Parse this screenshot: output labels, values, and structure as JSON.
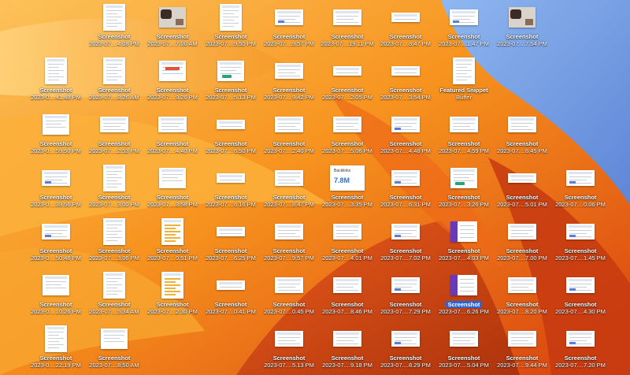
{
  "wallpaper": {
    "name": "macos-ventura-orange",
    "colors": [
      "#fbb03b",
      "#f7931e",
      "#e8520f",
      "#c63a10",
      "#7aa6e8"
    ]
  },
  "desktop": {
    "rows": [
      {
        "icons": [
          {
            "name": "Screenshot",
            "sub": "2023-07....4.08 PM",
            "thumb": "doc"
          },
          {
            "name": "Screenshot",
            "sub": "2023-07....7.00 AM",
            "thumb": "photo"
          },
          {
            "name": "Screenshot",
            "sub": "2023-07....9.50 PM",
            "thumb": "doc"
          },
          {
            "name": "Screenshot",
            "sub": "2023-07....9.57 PM",
            "thumb": "wide"
          },
          {
            "name": "Screenshot",
            "sub": "2023-07....19.11 PM",
            "thumb": "wide"
          },
          {
            "name": "Screenshot",
            "sub": "2023-07....8.47 PM",
            "thumb": "narrow"
          },
          {
            "name": "Screenshot",
            "sub": "2023-07....1.47 PM",
            "thumb": "wide"
          },
          {
            "name": "Screenshot",
            "sub": "2023-07....7.54 PM",
            "thumb": "photo"
          }
        ]
      },
      {
        "icons": [
          {
            "name": "Screenshot",
            "sub": "2023-0....41.48 PM",
            "thumb": "tall"
          },
          {
            "name": "Screenshot",
            "sub": "2023-07....8.26 AM",
            "thumb": "tall"
          },
          {
            "name": "Screenshot",
            "sub": "2023-07....9.26 PM",
            "thumb": "redbtn"
          },
          {
            "name": "Screenshot",
            "sub": "2023-07....5.13 PM",
            "thumb": "greenbtn"
          },
          {
            "name": "Screenshot",
            "sub": "2023-07....9.42 PM",
            "thumb": "wide"
          },
          {
            "name": "Screenshot",
            "sub": "2023-07....2.05 PM",
            "thumb": "narrow"
          },
          {
            "name": "Screenshot",
            "sub": "2023-07....3.54 PM",
            "thumb": "narrow"
          },
          {
            "name": "Featured Snippet",
            "sub": "Buffer",
            "thumb": "doc"
          }
        ]
      },
      {
        "icons": [
          {
            "name": "Screenshot",
            "sub": "2023-0....59.50 PM",
            "thumb": "std"
          },
          {
            "name": "Screenshot",
            "sub": "2023-07....2.53 PM",
            "thumb": "wide"
          },
          {
            "name": "Screenshot",
            "sub": "2023-07....4.40 PM",
            "thumb": "wide"
          },
          {
            "name": "Screenshot",
            "sub": "2023-07....6.50 PM",
            "thumb": "narrow"
          },
          {
            "name": "Screenshot",
            "sub": "2023-07....2.40 PM",
            "thumb": "wide"
          },
          {
            "name": "Screenshot",
            "sub": "2023-07....5.06 PM",
            "thumb": "wide"
          },
          {
            "name": "Screenshot",
            "sub": "2023-07....4.48 PM",
            "thumb": "wide"
          },
          {
            "name": "Screenshot",
            "sub": "2023-07....4.59 PM",
            "thumb": "wide"
          },
          {
            "name": "Screenshot",
            "sub": "2023-07....6.45 PM",
            "thumb": "wide"
          }
        ]
      },
      {
        "icons": [
          {
            "name": "Screenshot",
            "sub": "2023-0....39.56 PM",
            "thumb": "wide"
          },
          {
            "name": "Screenshot",
            "sub": "2023-07....3.00 PM",
            "thumb": "tall"
          },
          {
            "name": "Screenshot",
            "sub": "2023-07....3.58 PM",
            "thumb": "std"
          },
          {
            "name": "Screenshot",
            "sub": "2023-07....6.16 PM",
            "thumb": "narrow"
          },
          {
            "name": "Screenshot",
            "sub": "2023-07....8.47 PM",
            "thumb": "wide"
          },
          {
            "name": "Screenshot",
            "sub": "2023-07....3.35 PM",
            "thumb": "backlinks",
            "label": "Backlinks",
            "value": "7.8M"
          },
          {
            "name": "Screenshot",
            "sub": "2023-07....6.31 PM",
            "thumb": "wide"
          },
          {
            "name": "Screenshot",
            "sub": "2023-07....3.26 PM",
            "thumb": "greenbtn"
          },
          {
            "name": "Screenshot",
            "sub": "2023-07....5.01 PM",
            "thumb": "narrow"
          },
          {
            "name": "Screenshot",
            "sub": "2023-07....0.06 PM",
            "thumb": "wide"
          }
        ]
      },
      {
        "icons": [
          {
            "name": "Screenshot",
            "sub": "2023-0....50.46 PM",
            "thumb": "wide"
          },
          {
            "name": "Screenshot",
            "sub": "2023-07....3.06 PM",
            "thumb": "tall"
          },
          {
            "name": "Screenshot",
            "sub": "2023-07....0.51 PM",
            "thumb": "yellowdoc"
          },
          {
            "name": "Screenshot",
            "sub": "2023-07....6.25 PM",
            "thumb": "narrow"
          },
          {
            "name": "Screenshot",
            "sub": "2023-07....9.57 PM",
            "thumb": "wide"
          },
          {
            "name": "Screenshot",
            "sub": "2023-07....4.01 PM",
            "thumb": "wide"
          },
          {
            "name": "Screenshot",
            "sub": "2023-07....7.02 PM",
            "thumb": "wide"
          },
          {
            "name": "Screenshot",
            "sub": "2023-07....4.03 PM",
            "thumb": "purple"
          },
          {
            "name": "Screenshot",
            "sub": "2023-07....7.00 PM",
            "thumb": "wide"
          },
          {
            "name": "Screenshot",
            "sub": "2023-07....1.45 PM",
            "thumb": "wide"
          }
        ]
      },
      {
        "icons": [
          {
            "name": "Screenshot",
            "sub": "2023-0....10.26 PM",
            "thumb": "std"
          },
          {
            "name": "Screenshot",
            "sub": "2023-07....5.34 AM",
            "thumb": "tall"
          },
          {
            "name": "Screenshot",
            "sub": "2023-07....2.30 PM",
            "thumb": "yellowdoc"
          },
          {
            "name": "Screenshot",
            "sub": "2023-07....0.41 PM",
            "thumb": "narrow"
          },
          {
            "name": "Screenshot",
            "sub": "2023-07....0.45 PM",
            "thumb": "wide"
          },
          {
            "name": "Screenshot",
            "sub": "2023-07....8.46 PM",
            "thumb": "wide"
          },
          {
            "name": "Screenshot",
            "sub": "2023-07....7.29 PM",
            "thumb": "wide"
          },
          {
            "name": "Screenshot",
            "sub": "2023-07....6.26 PM",
            "thumb": "purple",
            "selected": true
          },
          {
            "name": "Screenshot",
            "sub": "2023-07....8.20 PM",
            "thumb": "wide"
          },
          {
            "name": "Screenshot",
            "sub": "2023-07....4.30 PM",
            "thumb": "wide"
          }
        ]
      },
      {
        "icons": [
          {
            "name": "Screenshot",
            "sub": "2023-0....22.19 PM",
            "thumb": "tall"
          },
          {
            "name": "Screenshot",
            "sub": "2023-07....8.50 AM",
            "thumb": "std"
          },
          {
            "name": "",
            "sub": "",
            "thumb": "none"
          },
          {
            "name": "",
            "sub": "",
            "thumb": "none"
          },
          {
            "name": "Screenshot",
            "sub": "2023-07....5.13 PM",
            "thumb": "wide"
          },
          {
            "name": "Screenshot",
            "sub": "2023-07....9.18 PM",
            "thumb": "wide"
          },
          {
            "name": "Screenshot",
            "sub": "2023-07....8.29 PM",
            "thumb": "wide"
          },
          {
            "name": "Screenshot",
            "sub": "2023-07....5.04 PM",
            "thumb": "wide"
          },
          {
            "name": "Screenshot",
            "sub": "2023-07....9.44 PM",
            "thumb": "wide"
          },
          {
            "name": "Screenshot",
            "sub": "2023-07....7.20 PM",
            "thumb": "wide"
          }
        ]
      }
    ]
  }
}
